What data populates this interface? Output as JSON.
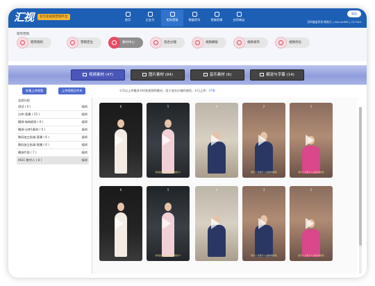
{
  "app": {
    "logo_text": "汇视",
    "logo_badge": "多元化视频营销平台",
    "login_label": "退出",
    "user_info": "深圳鑫盛贸易·数推乐 | dshuer668 | 237180"
  },
  "nav": [
    {
      "label": "首页",
      "icon": "home-icon"
    },
    {
      "label": "企业号",
      "icon": "enterprise-icon"
    },
    {
      "label": "矩阵营销",
      "icon": "matrix-icon",
      "active": true
    },
    {
      "label": "数据资讯",
      "icon": "chart-icon"
    },
    {
      "label": "智能剪辑",
      "icon": "edit-icon"
    },
    {
      "label": "应用商店",
      "icon": "store-icon"
    }
  ],
  "categories": {
    "title": "矩阵营销",
    "items": [
      {
        "label": "矩阵授权",
        "icon": "authorize-icon"
      },
      {
        "label": "营销定位",
        "icon": "target-icon"
      },
      {
        "label": "素材中心",
        "icon": "material-icon",
        "active": true
      },
      {
        "label": "混合分镜",
        "icon": "mix-icon"
      },
      {
        "label": "视频模板",
        "icon": "template-icon"
      },
      {
        "label": "视频发布",
        "icon": "publish-icon"
      },
      {
        "label": "视频优化",
        "icon": "optimize-icon"
      }
    ]
  },
  "types": [
    {
      "label": "视频素材",
      "count": "(47)",
      "active": true
    },
    {
      "label": "图片素材",
      "count": "(84)"
    },
    {
      "label": "音乐素材",
      "count": "(6)"
    },
    {
      "label": "解说与字幕",
      "count": "(14)"
    }
  ],
  "toolbar": {
    "upload_video": "批量上传视频",
    "upload_folder": "上传视频文件夹",
    "tip_text": "①可以上传最多100条视频到素材，用于混合分镜的使用，①已上传：",
    "tip_count": "47条"
  },
  "group_list": {
    "header": "全部分组",
    "edit_label": "编辑",
    "items": [
      {
        "label": "测试 ( 0 )"
      },
      {
        "label": "分库-直播 ( 15 )"
      },
      {
        "label": "播源-电商趋势 ( 6 )"
      },
      {
        "label": "播源-分库1素材 ( 5 )"
      },
      {
        "label": "数码加工私域-直播 ( 6 )"
      },
      {
        "label": "数码加工私域-直播 ( 6 )"
      },
      {
        "label": "播源片段 ( 7 )"
      },
      {
        "label": "AIGC-数字人 ( 6 )",
        "selected": true
      }
    ]
  },
  "videos": [
    {
      "index": "6",
      "style": "dark",
      "person": "white",
      "caption": ""
    },
    {
      "index": "5",
      "style": "hall",
      "person": "pink",
      "caption": "深圳鑫盛贸易·全屏主播数字人"
    },
    {
      "index": "4",
      "style": "light",
      "person": "navy",
      "caption": ""
    },
    {
      "index": "2",
      "style": "warm",
      "person": "navy",
      "caption": "数字人·新数字人主播讲解视频"
    },
    {
      "index": "1",
      "style": "warm",
      "person": "magenta",
      "caption": "数字人·新数字人主播讲解视频"
    },
    {
      "index": "6",
      "style": "dark",
      "person": "white",
      "caption": ""
    },
    {
      "index": "5",
      "style": "hall",
      "person": "pink",
      "caption": "深圳鑫盛贸易·全屏主播数字人"
    },
    {
      "index": "3",
      "style": "light",
      "person": "navy",
      "caption": ""
    },
    {
      "index": "3",
      "style": "warm",
      "person": "navy",
      "caption": "数字人·新数字人主播讲解视频"
    },
    {
      "index": "2",
      "style": "warm",
      "person": "magenta",
      "caption": "数字人·新数字人主播讲解视频"
    }
  ],
  "colors": {
    "nav_bg": "#1d5fb5",
    "accent": "#4a57b8",
    "category_icon": "#e84b64"
  }
}
